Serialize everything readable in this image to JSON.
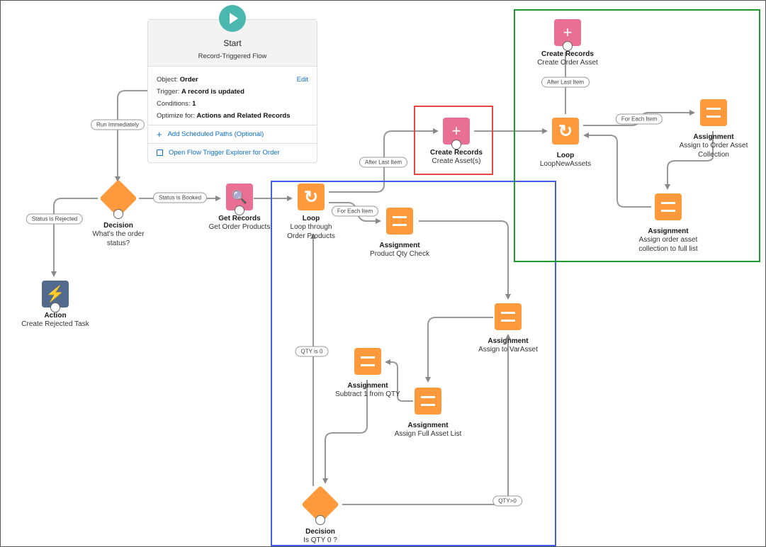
{
  "start": {
    "title": "Start",
    "subtitle": "Record-Triggered Flow",
    "object_label": "Object:",
    "object_value": "Order",
    "edit_label": "Edit",
    "trigger_label": "Trigger:",
    "trigger_value": "A record is updated",
    "conditions_label": "Conditions:",
    "conditions_value": "1",
    "optimize_label": "Optimize for:",
    "optimize_value": "Actions and Related Records",
    "add_paths_label": "Add Scheduled Paths (Optional)",
    "explorer_label": "Open Flow Trigger Explorer for Order"
  },
  "nodes": {
    "decision_status": {
      "title": "Decision",
      "sub": "What's the order status?"
    },
    "action_rejected": {
      "title": "Action",
      "sub": "Create Rejected Task"
    },
    "get_records": {
      "title": "Get Records",
      "sub": "Get Order Products"
    },
    "loop_products": {
      "title": "Loop",
      "sub": "Loop through Order Products"
    },
    "assign_qty_check": {
      "title": "Assignment",
      "sub": "Product Qty Check"
    },
    "create_assets": {
      "title": "Create Records",
      "sub": "Create Asset(s)"
    },
    "loop_new_assets": {
      "title": "Loop",
      "sub": "LoopNewAssets"
    },
    "create_order_asset": {
      "title": "Create Records",
      "sub": "Create Order Asset"
    },
    "assign_order_asset_collection": {
      "title": "Assignment",
      "sub": "Assign to Order Asset Collection"
    },
    "assign_collection_full": {
      "title": "Assignment",
      "sub": "Assign order asset collection to full list"
    },
    "assign_varasset": {
      "title": "Assignment",
      "sub": "Assign to VarAsset"
    },
    "assign_subtract": {
      "title": "Assignment",
      "sub": "Subtract 1 from QTY"
    },
    "assign_full_list": {
      "title": "Assignment",
      "sub": "Assign Full Asset List"
    },
    "decision_qty": {
      "title": "Decision",
      "sub": "Is QTY 0 ?"
    }
  },
  "connectors": {
    "run_immediately": "Run Immediately",
    "status_rejected": "Status is Rejected",
    "status_booked": "Status is Booked",
    "after_last_item_1": "After Last Item",
    "for_each_item_1": "For Each Item",
    "after_last_item_2": "After Last Item",
    "for_each_item_2": "For Each Item",
    "qty_is_0": "QTY is 0",
    "qty_gt_0": "QTY>0"
  },
  "highlights": {
    "red": "#e84545",
    "blue": "#3f5de8",
    "green": "#1e9a2e"
  }
}
